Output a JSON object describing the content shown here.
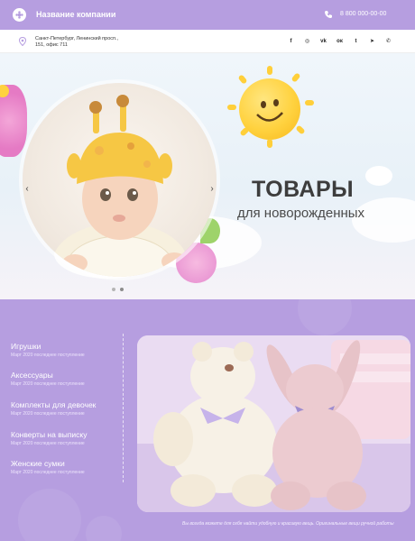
{
  "header": {
    "company_name": "Название компании",
    "phone": "8 800 000-00-00",
    "icons": {
      "logo": "company-logo-icon",
      "phone": "phone-icon"
    }
  },
  "infobar": {
    "address_line1": "Санкт-Петербург, Ленинский просп.,",
    "address_line2": "151, офис 711",
    "socials": [
      {
        "name": "facebook",
        "glyph": "f"
      },
      {
        "name": "instagram",
        "glyph": "◎"
      },
      {
        "name": "vk",
        "glyph": "vk"
      },
      {
        "name": "odnoklassniki",
        "glyph": "ок"
      },
      {
        "name": "twitter",
        "glyph": "t"
      },
      {
        "name": "telegram",
        "glyph": "➤"
      },
      {
        "name": "whatsapp",
        "glyph": "✆"
      }
    ]
  },
  "hero": {
    "title": "ТОВАРЫ",
    "subtitle": "для новорожденных",
    "prev_arrow": "‹",
    "next_arrow": "›"
  },
  "catalog": {
    "items": [
      {
        "title": "Игрушки",
        "subtitle": "Март 2020 последнее поступление"
      },
      {
        "title": "Аксессуары",
        "subtitle": "Март 2020 последнее поступление"
      },
      {
        "title": "Комплекты для девочек",
        "subtitle": "Март 2020 последнее поступление"
      },
      {
        "title": "Конверты на выписку",
        "subtitle": "Март 2020 последнее поступление"
      },
      {
        "title": "Женские сумки",
        "subtitle": "Март 2020 последнее поступление"
      }
    ],
    "footer_text": "Вы всегда можете для себя найти удобную и красивую вещь. Оригинальные вещи ручной работы"
  },
  "colors": {
    "accent": "#b69ee0",
    "text": "#3d3d3d",
    "sun": "#ffd23f"
  }
}
